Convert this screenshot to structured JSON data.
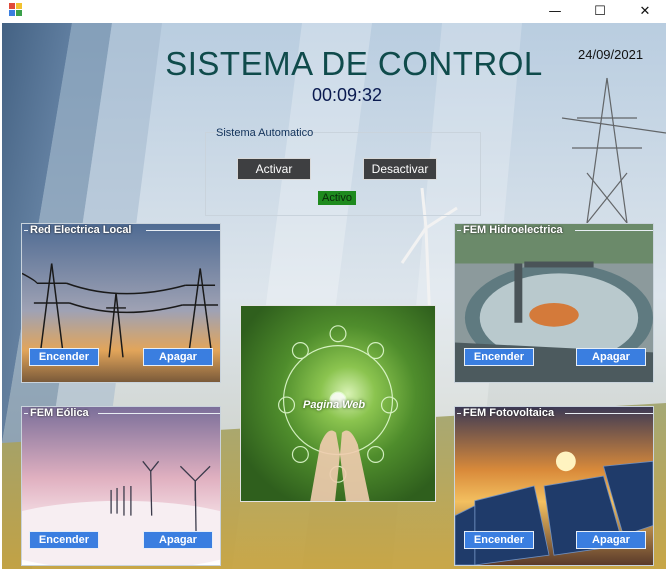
{
  "window": {
    "minimize_glyph": "—",
    "maximize_glyph": "☐",
    "close_glyph": "✕"
  },
  "header": {
    "title": "SISTEMA DE CONTROL",
    "clock": "00:09:32",
    "date": "24/09/2021"
  },
  "auto_group": {
    "legend": "Sistema Automatico",
    "activate_label": "Activar",
    "deactivate_label": "Desactivar",
    "status_text": "Activo",
    "status_color": "#1e8a1e"
  },
  "panels": {
    "local": {
      "legend": "Red Electrica Local",
      "on_label": "Encender",
      "off_label": "Apagar"
    },
    "hydro": {
      "legend": "FEM Hidroelectrica",
      "on_label": "Encender",
      "off_label": "Apagar"
    },
    "wind": {
      "legend": "FEM Eólica",
      "on_label": "Encender",
      "off_label": "Apagar"
    },
    "solar": {
      "legend": "FEM Fotovoltaica",
      "on_label": "Encender",
      "off_label": "Apagar"
    }
  },
  "web": {
    "label": "Pagina Web"
  },
  "colors": {
    "title": "#0f4b4b",
    "button_dark": "#3e3f41",
    "button_blue": "#3a7ee0"
  }
}
